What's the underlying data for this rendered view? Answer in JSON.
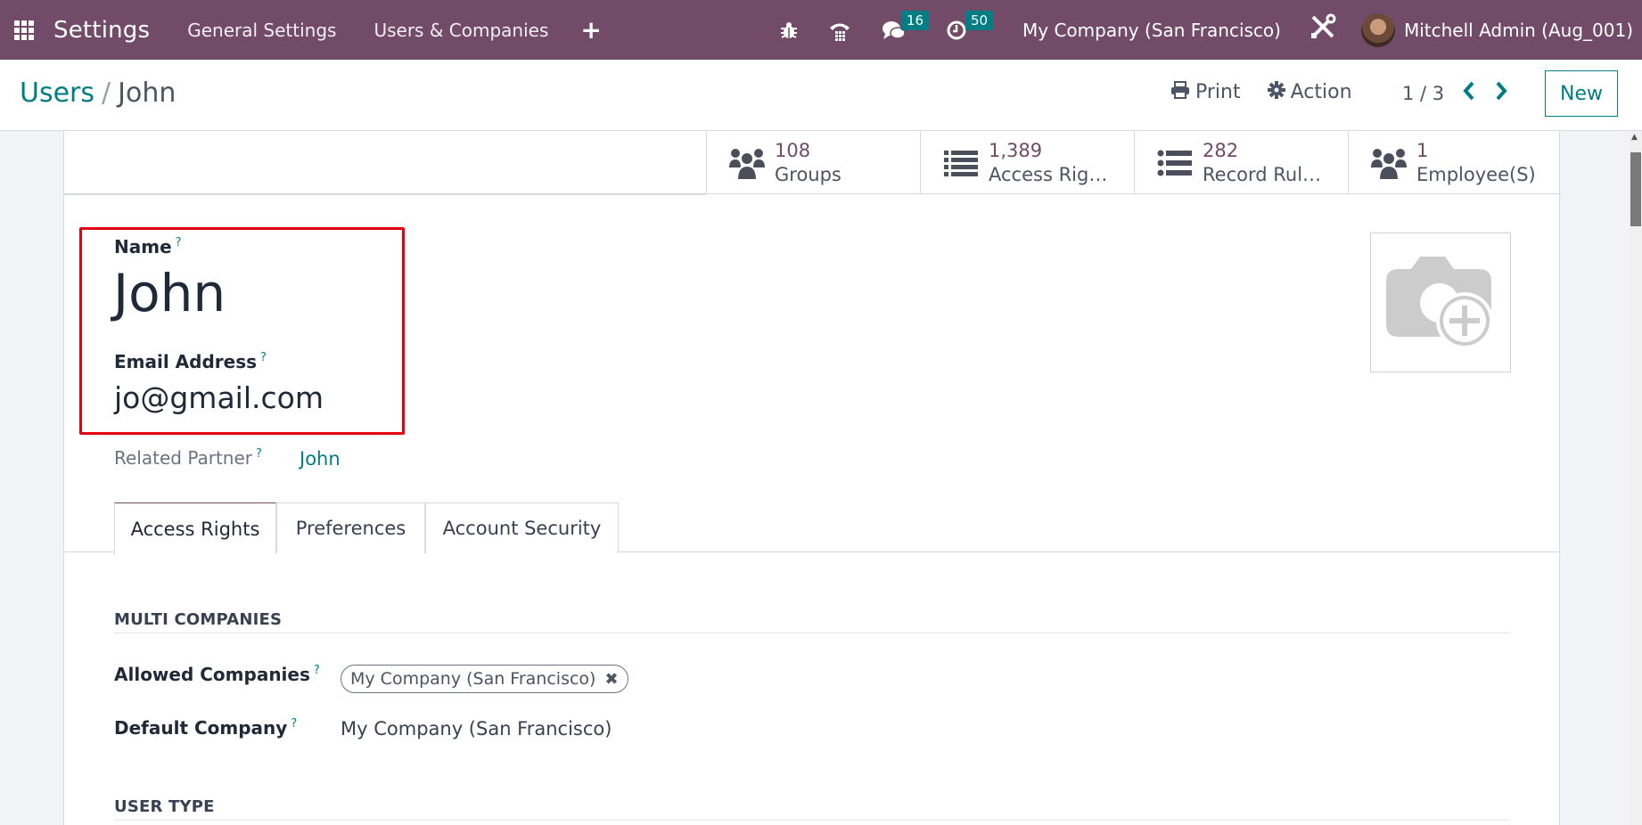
{
  "navbar": {
    "app_name": "Settings",
    "menus": [
      "General Settings",
      "Users & Companies"
    ],
    "plus_icon": "plus-icon",
    "icons": {
      "debug": "bug-icon",
      "phone": "phone-icon",
      "messages": "chat-icon",
      "activities": "clock-icon"
    },
    "messages_count": "16",
    "activities_count": "50",
    "company": "My Company (San Francisco)",
    "user": "Mitchell Admin (Aug_001)",
    "colors": {
      "brand": "#714B67",
      "badge": "#017E84"
    }
  },
  "control_panel": {
    "breadcrumb": {
      "parent": "Users",
      "separator": "/",
      "current": "John"
    },
    "print_label": "Print",
    "action_label": "Action",
    "pager": "1 / 3",
    "new_label": "New"
  },
  "stat_buttons": [
    {
      "icon": "users-icon",
      "value": "108",
      "label": "Groups"
    },
    {
      "icon": "list-icon",
      "value": "1,389",
      "label": "Access Rig…"
    },
    {
      "icon": "list-ul-icon",
      "value": "282",
      "label": "Record Rul…"
    },
    {
      "icon": "users-icon",
      "value": "1",
      "label": "Employee(S)"
    }
  ],
  "form": {
    "name_label": "Name",
    "name_value": "John",
    "email_label": "Email Address",
    "email_value": "jo@gmail.com",
    "related_partner_label": "Related Partner",
    "related_partner_value": "John",
    "help_mark": "?",
    "avatar_placeholder": "camera-plus-icon"
  },
  "tabs": [
    {
      "label": "Access Rights",
      "active": true
    },
    {
      "label": "Preferences",
      "active": false
    },
    {
      "label": "Account Security",
      "active": false
    }
  ],
  "access_rights": {
    "multi_companies_title": "MULTI COMPANIES",
    "allowed_companies_label": "Allowed Companies",
    "allowed_companies": [
      "My Company (San Francisco)"
    ],
    "default_company_label": "Default Company",
    "default_company_value": "My Company (San Francisco)",
    "user_type_title": "USER TYPE"
  }
}
